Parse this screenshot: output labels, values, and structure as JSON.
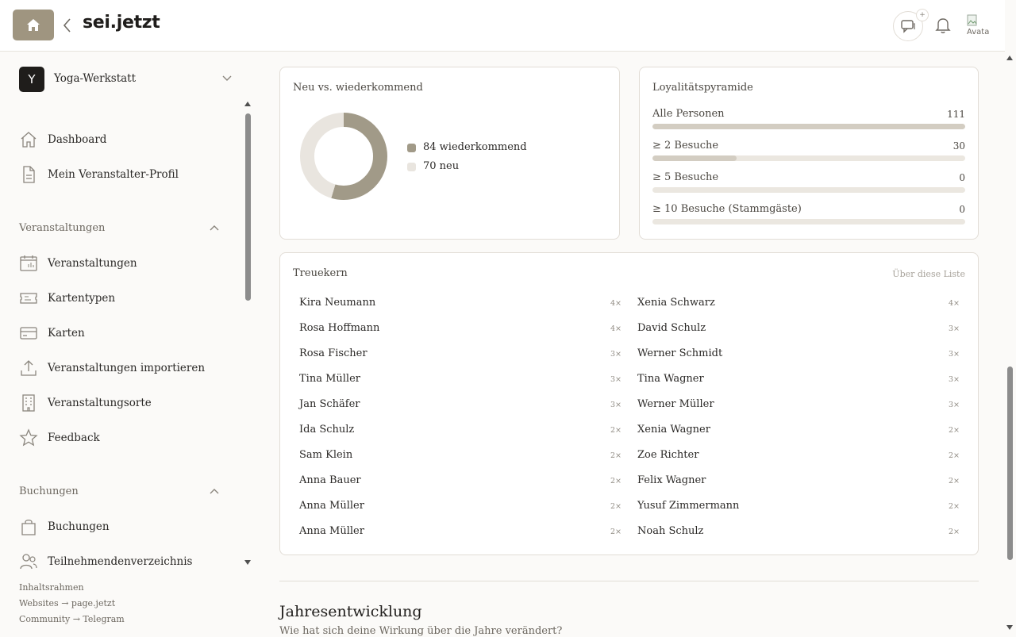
{
  "header": {
    "brand": "sei.jetzt",
    "chat_badge": "+",
    "avatar_alt": "Avatar"
  },
  "sidebar": {
    "workspace": {
      "initial": "Y",
      "name": "Yoga-Werkstatt"
    },
    "top_items": [
      {
        "label": "Dashboard",
        "icon": "home-icon"
      },
      {
        "label": "Mein Veranstalter-Profil",
        "icon": "document-icon"
      }
    ],
    "sections": [
      {
        "title": "Veranstaltungen",
        "items": [
          {
            "label": "Veranstaltungen",
            "icon": "calendar-icon"
          },
          {
            "label": "Kartentypen",
            "icon": "ticket-icon"
          },
          {
            "label": "Karten",
            "icon": "card-icon"
          },
          {
            "label": "Veranstaltungen importieren",
            "icon": "upload-icon"
          },
          {
            "label": "Veranstaltungsorte",
            "icon": "building-icon"
          },
          {
            "label": "Feedback",
            "icon": "star-icon"
          }
        ]
      },
      {
        "title": "Buchungen",
        "items": [
          {
            "label": "Buchungen",
            "icon": "shopping-bag-icon"
          },
          {
            "label": "Teilnehmendenverzeichnis",
            "icon": "users-icon"
          }
        ]
      }
    ],
    "footer": [
      "Inhaltsrahmen",
      "Websites → page.jetzt",
      "Community → Telegram"
    ]
  },
  "new_vs_returning": {
    "title": "Neu vs. wiederkommend",
    "legend": [
      {
        "label": "84 wiederkommend",
        "color": "#a19a88"
      },
      {
        "label": "70 neu",
        "color": "#e9e5df"
      }
    ]
  },
  "chart_data": {
    "type": "pie",
    "title": "Neu vs. wiederkommend",
    "categories": [
      "wiederkommend",
      "neu"
    ],
    "values": [
      84,
      70
    ],
    "colors": [
      "#a19a88",
      "#e9e5df"
    ],
    "donut": true
  },
  "loyalty": {
    "title": "Loyalitätspyramide",
    "rows": [
      {
        "label": "Alle Personen",
        "value": "111",
        "fraction": 1.0
      },
      {
        "label": "≥ 2 Besuche",
        "value": "30",
        "fraction": 0.27
      },
      {
        "label": "≥ 5 Besuche",
        "value": "0",
        "fraction": 0
      },
      {
        "label": "≥ 10 Besuche (Stammgäste)",
        "value": "0",
        "fraction": 0
      }
    ]
  },
  "treuekern": {
    "title": "Treuekern",
    "link": "Über diese Liste",
    "left": [
      {
        "name": "Kira Neumann",
        "count": "4×"
      },
      {
        "name": "Rosa Hoffmann",
        "count": "4×"
      },
      {
        "name": "Rosa Fischer",
        "count": "3×"
      },
      {
        "name": "Tina Müller",
        "count": "3×"
      },
      {
        "name": "Jan Schäfer",
        "count": "3×"
      },
      {
        "name": "Ida Schulz",
        "count": "2×"
      },
      {
        "name": "Sam Klein",
        "count": "2×"
      },
      {
        "name": "Anna Bauer",
        "count": "2×"
      },
      {
        "name": "Anna Müller",
        "count": "2×"
      },
      {
        "name": "Anna Müller",
        "count": "2×"
      }
    ],
    "right": [
      {
        "name": "Xenia Schwarz",
        "count": "4×"
      },
      {
        "name": "David Schulz",
        "count": "3×"
      },
      {
        "name": "Werner Schmidt",
        "count": "3×"
      },
      {
        "name": "Tina Wagner",
        "count": "3×"
      },
      {
        "name": "Werner Müller",
        "count": "3×"
      },
      {
        "name": "Xenia Wagner",
        "count": "2×"
      },
      {
        "name": "Zoe Richter",
        "count": "2×"
      },
      {
        "name": "Felix Wagner",
        "count": "2×"
      },
      {
        "name": "Yusuf Zimmermann",
        "count": "2×"
      },
      {
        "name": "Noah Schulz",
        "count": "2×"
      }
    ]
  },
  "annual": {
    "title": "Jahresentwicklung",
    "subtitle": "Wie hat sich deine Wirkung über die Jahre verändert?"
  }
}
